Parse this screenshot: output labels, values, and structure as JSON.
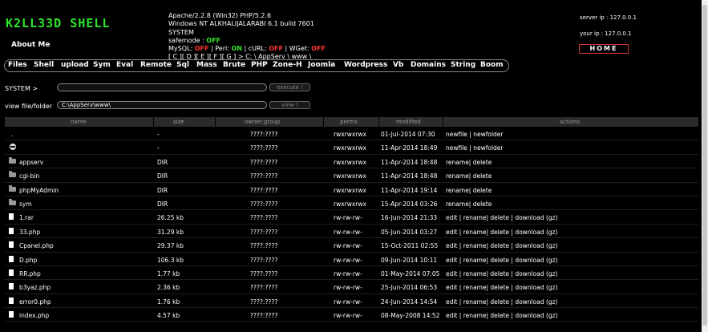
{
  "header": {
    "logo": "K2LL33D SHELL",
    "about": "About Me",
    "server_line": "Apache/2.2.8 (Win32) PHP/5.2.6",
    "os_line": "Windows NT ALKHALIJALARABI 6.1 build 7601",
    "user_line": "SYSTEM",
    "safemode_label": "safemode : ",
    "safemode_value": "OFF",
    "mysql_label": "MySQL: ",
    "mysql_value": "OFF",
    "perl_label": " | Perl: ",
    "perl_value": "ON",
    "curl_label": " | cURL: ",
    "curl_value": "OFF",
    "wget_label": " | WGet: ",
    "wget_value": "OFF",
    "drives": [
      "[ C ]",
      "[ D ]",
      "[ E ]",
      "[ F ]",
      "[ G ]"
    ],
    "path": " > C: \\ AppServ \\ www \\",
    "server_ip": "server ip : 127.0.0.1",
    "your_ip": "your ip : 127.0.0.1",
    "home": "HOME"
  },
  "nav": [
    "Files",
    "Shell",
    "upload",
    "Sym",
    "Eval",
    "Remote",
    "Sql",
    "Mass",
    "Brute",
    "PHP",
    "Zone-H",
    "Joomla",
    "Wordpress",
    "Vb",
    "Domains",
    "String",
    "Boom"
  ],
  "system": {
    "label": "SYSTEM >",
    "value": "",
    "button": "execute !"
  },
  "view": {
    "label": "view file/folder",
    "value": "C:\\AppServ\\www\\",
    "button": "view !"
  },
  "table": {
    "headers": [
      "name",
      "size",
      "owner:group",
      "perms",
      "modified",
      "actions"
    ],
    "rows": [
      {
        "icon": "none",
        "name": ".",
        "size": "-",
        "owner": "????:????",
        "perms": "rwxrwxrwx",
        "modified": "01-Jul-2014 07:30",
        "actions": "newfile | newfolder"
      },
      {
        "icon": "updir",
        "name": "",
        "size": "-",
        "owner": "????:????",
        "perms": "rwxrwxrwx",
        "modified": "11-Apr-2014 18:49",
        "actions": "newfile | newfolder"
      },
      {
        "icon": "folder",
        "name": "appserv",
        "size": "DIR",
        "owner": "????:????",
        "perms": "rwxrwxrwx",
        "modified": "11-Apr-2014 18:48",
        "actions": "rename| delete"
      },
      {
        "icon": "folder",
        "name": "cgi-bin",
        "size": "DIR",
        "owner": "????:????",
        "perms": "rwxrwxrwx",
        "modified": "11-Apr-2014 18:48",
        "actions": "rename| delete"
      },
      {
        "icon": "folder",
        "name": "phpMyAdmin",
        "size": "DIR",
        "owner": "????:????",
        "perms": "rwxrwxrwx",
        "modified": "11-Apr-2014 19:14",
        "actions": "rename| delete"
      },
      {
        "icon": "folder",
        "name": "sym",
        "size": "DIR",
        "owner": "????:????",
        "perms": "rwxrwxrwx",
        "modified": "15-Apr-2014 03:26",
        "actions": "rename| delete"
      },
      {
        "icon": "file",
        "name": "1.rar",
        "size": "26.25 kb",
        "owner": "????:????",
        "perms": "rw-rw-rw-",
        "modified": "16-Jun-2014 21:33",
        "actions": "edit | rename| delete | download (gz)"
      },
      {
        "icon": "file",
        "name": "33.php",
        "size": "31.29 kb",
        "owner": "????:????",
        "perms": "rw-rw-rw-",
        "modified": "05-Jun-2014 03:27",
        "actions": "edit | rename| delete | download (gz)"
      },
      {
        "icon": "file",
        "name": "Cpanel.php",
        "size": "29.37 kb",
        "owner": "????:????",
        "perms": "rw-rw-rw-",
        "modified": "15-Oct-2011 02:55",
        "actions": "edit | rename| delete | download (gz)"
      },
      {
        "icon": "file",
        "name": "D.php",
        "size": "106.3 kb",
        "owner": "????:????",
        "perms": "rw-rw-rw-",
        "modified": "09-Jun-2014 10:11",
        "actions": "edit | rename| delete | download (gz)"
      },
      {
        "icon": "file",
        "name": "RR.php",
        "size": "1.77 kb",
        "owner": "????:????",
        "perms": "rw-rw-rw-",
        "modified": "01-May-2014 07:05",
        "actions": "edit | rename| delete | download (gz)"
      },
      {
        "icon": "file",
        "name": "b3yaz.php",
        "size": "2.36 kb",
        "owner": "????:????",
        "perms": "rw-rw-rw-",
        "modified": "25-Jun-2014 06:53",
        "actions": "edit | rename| delete | download (gz)"
      },
      {
        "icon": "file",
        "name": "error0.php",
        "size": "1.76 kb",
        "owner": "????:????",
        "perms": "rw-rw-rw-",
        "modified": "24-Jun-2014 14:54",
        "actions": "edit | rename| delete | download (gz)"
      },
      {
        "icon": "file",
        "name": "index.php",
        "size": "4.57 kb",
        "owner": "????:????",
        "perms": "rw-rw-rw-",
        "modified": "08-May-2008 14:52",
        "actions": "edit | rename| delete | download (gz)"
      }
    ]
  }
}
